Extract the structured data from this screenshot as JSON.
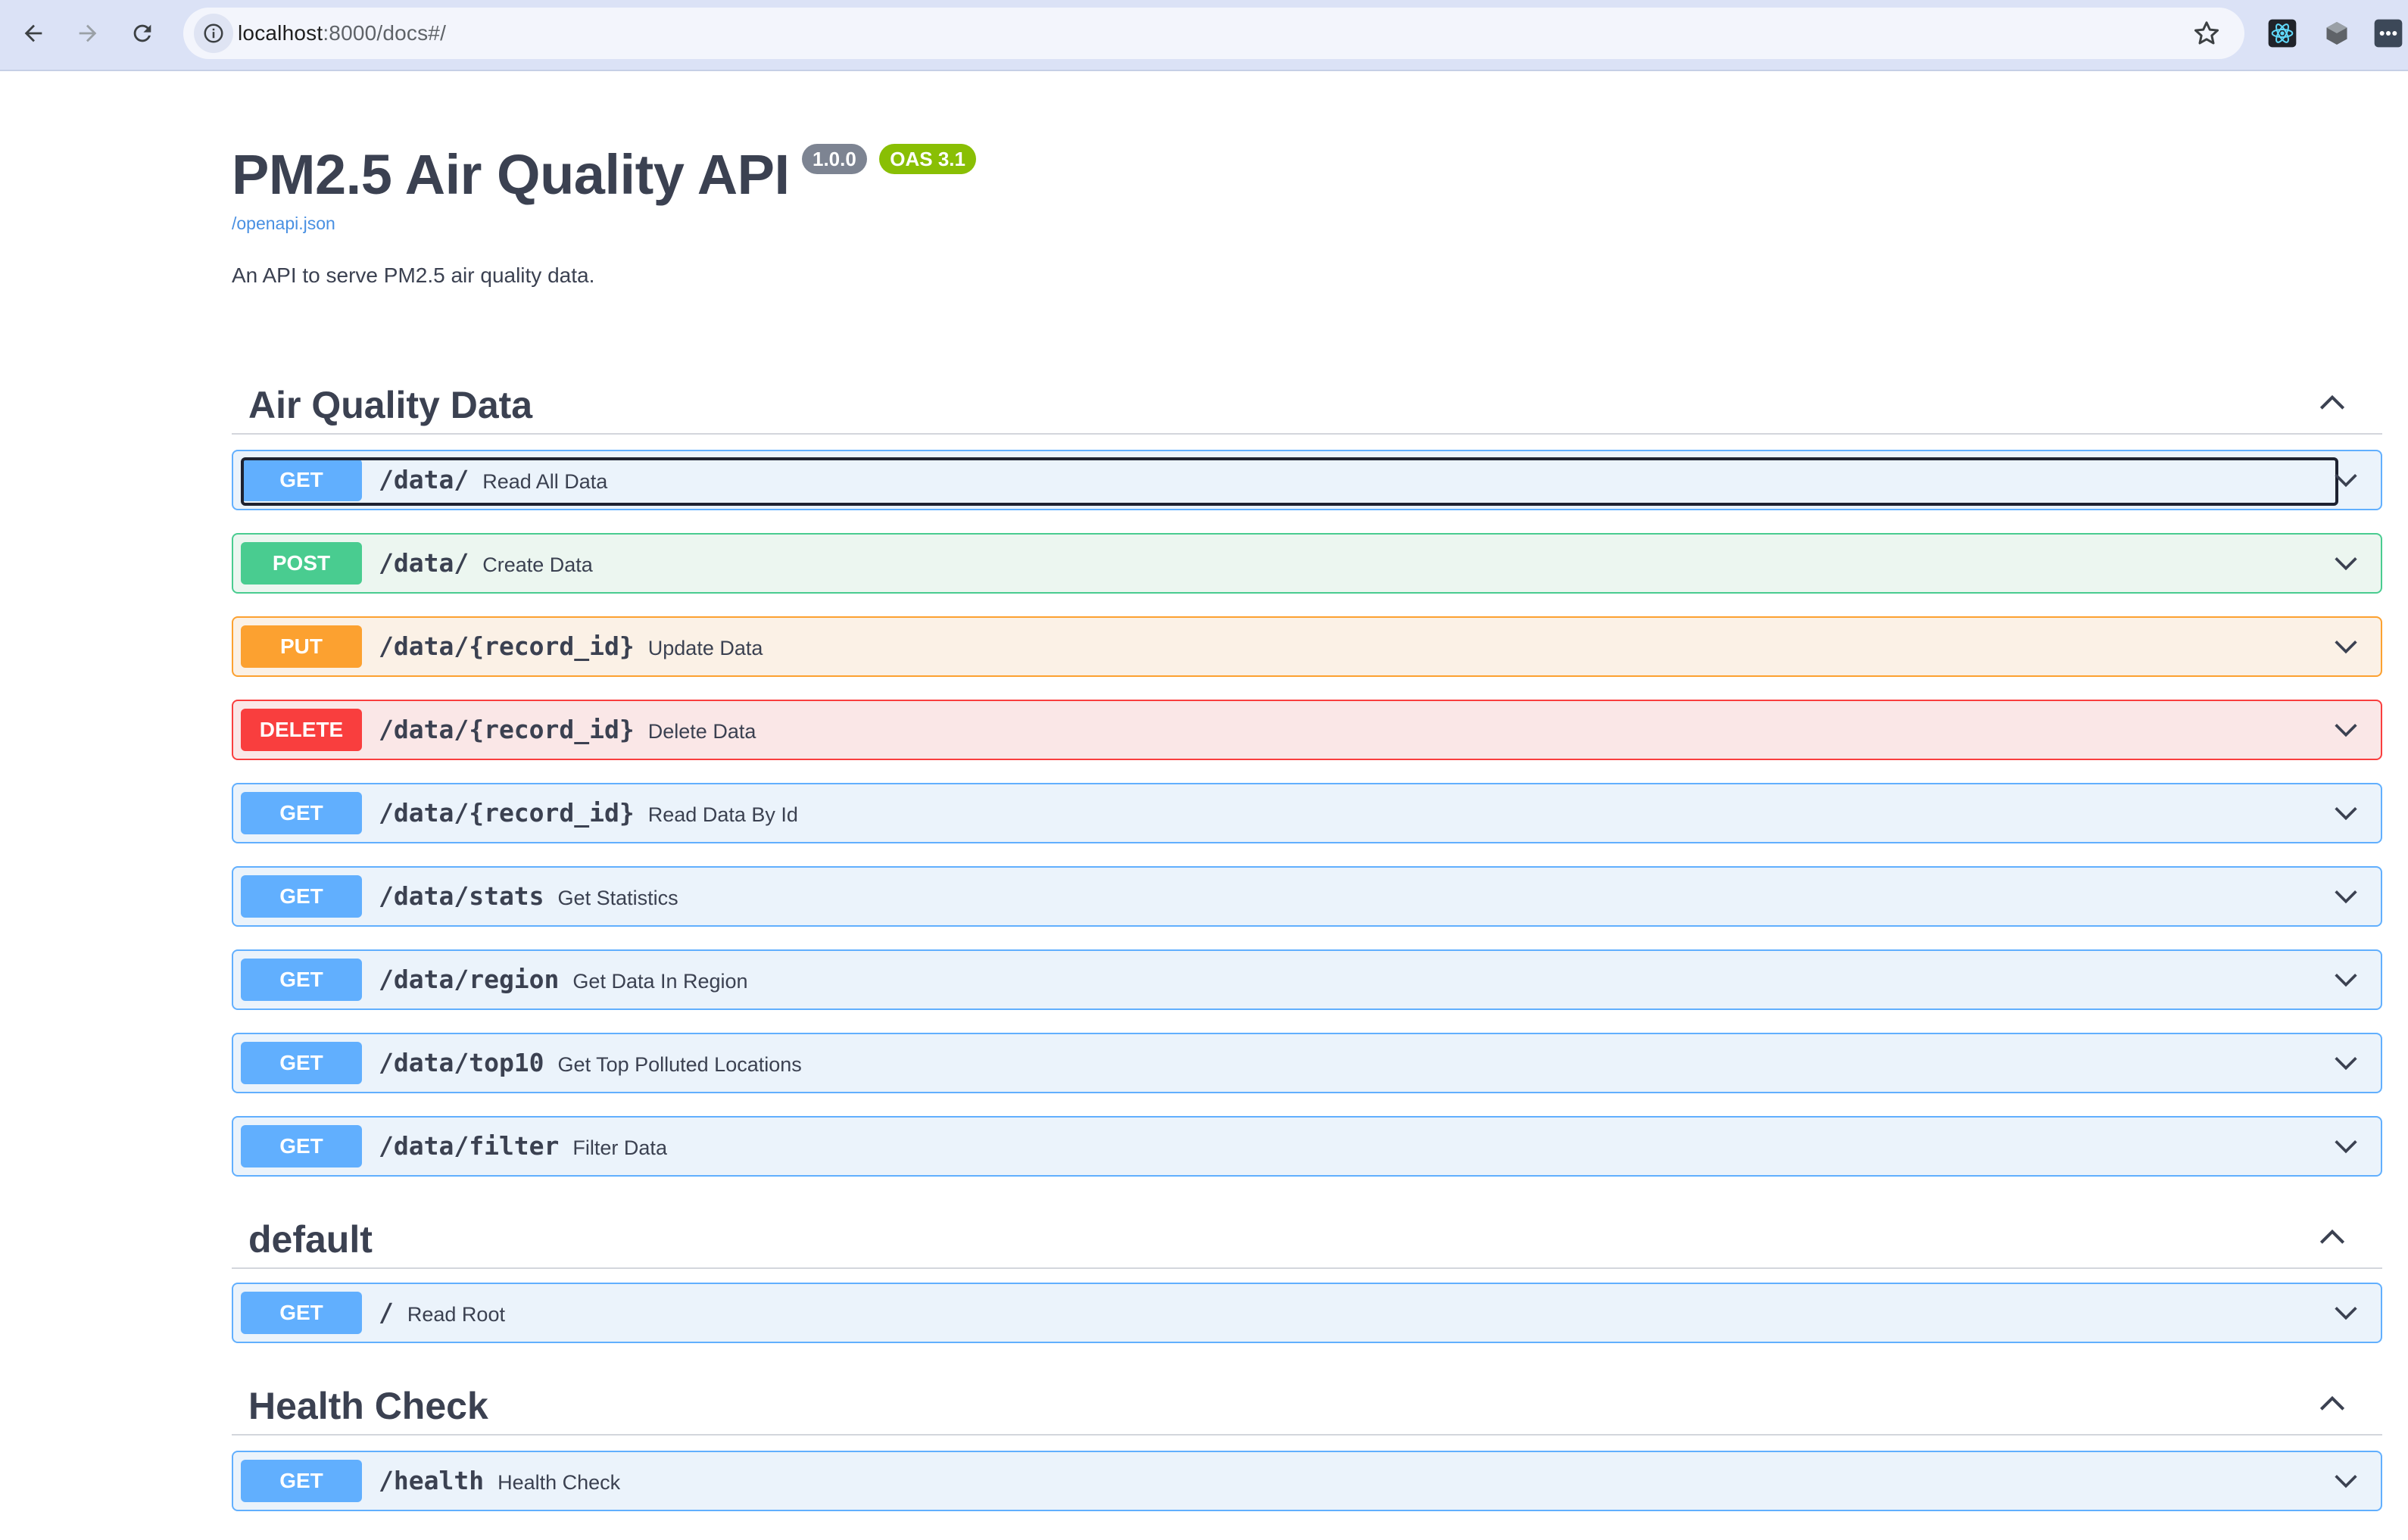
{
  "browser": {
    "url_host": "localhost",
    "url_rest": ":8000/docs#/"
  },
  "api": {
    "title": "PM2.5 Air Quality API",
    "version": "1.0.0",
    "oas": "OAS 3.1",
    "spec_link": "/openapi.json",
    "description": "An API to serve PM2.5 air quality data."
  },
  "tags": [
    {
      "name": "Air Quality Data",
      "operations": [
        {
          "method": "GET",
          "path": "/data/",
          "summary": "Read All Data"
        },
        {
          "method": "POST",
          "path": "/data/",
          "summary": "Create Data"
        },
        {
          "method": "PUT",
          "path": "/data/{record_id}",
          "summary": "Update Data"
        },
        {
          "method": "DELETE",
          "path": "/data/{record_id}",
          "summary": "Delete Data"
        },
        {
          "method": "GET",
          "path": "/data/{record_id}",
          "summary": "Read Data By Id"
        },
        {
          "method": "GET",
          "path": "/data/stats",
          "summary": "Get Statistics"
        },
        {
          "method": "GET",
          "path": "/data/region",
          "summary": "Get Data In Region"
        },
        {
          "method": "GET",
          "path": "/data/top10",
          "summary": "Get Top Polluted Locations"
        },
        {
          "method": "GET",
          "path": "/data/filter",
          "summary": "Filter Data"
        }
      ]
    },
    {
      "name": "default",
      "operations": [
        {
          "method": "GET",
          "path": "/",
          "summary": "Read Root"
        }
      ]
    },
    {
      "name": "Health Check",
      "operations": [
        {
          "method": "GET",
          "path": "/health",
          "summary": "Health Check"
        }
      ]
    }
  ],
  "colors": {
    "get": "#61affe",
    "post": "#49cc90",
    "put": "#fca130",
    "delete": "#f93e3e",
    "text": "#3b4151"
  }
}
